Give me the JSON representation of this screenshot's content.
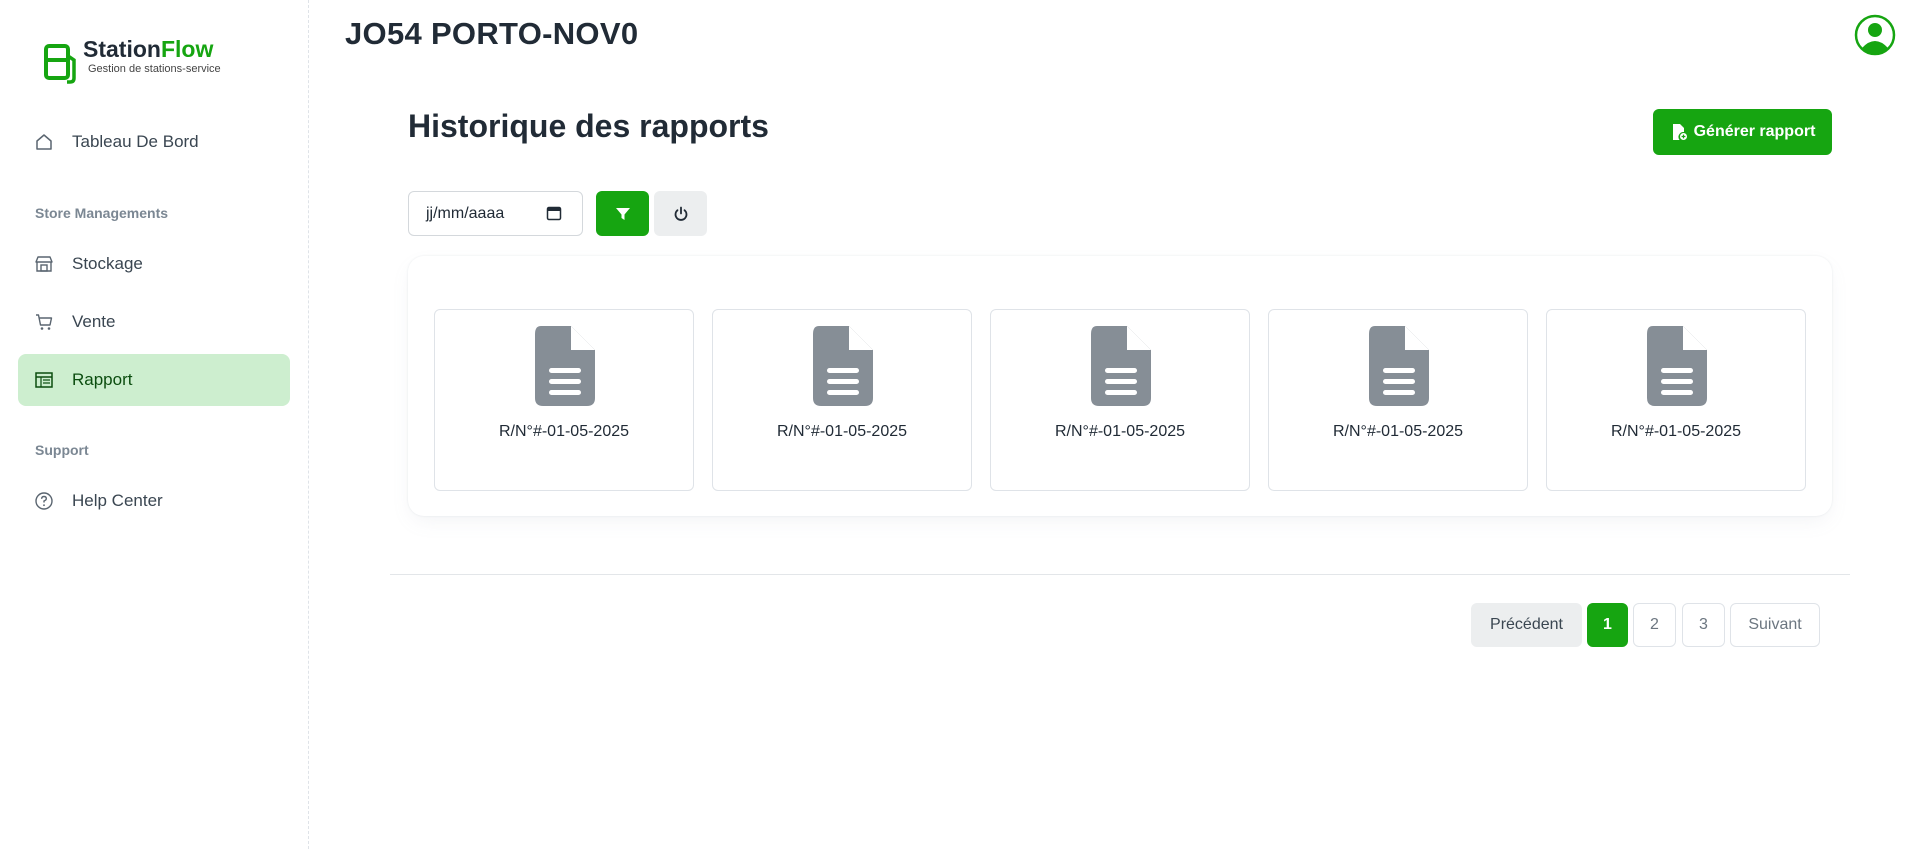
{
  "brand": {
    "name_part1": "Station",
    "name_part2": "Flow",
    "tagline": "Gestion de stations-service",
    "accent_color": "#16a511"
  },
  "sidebar": {
    "items": [
      {
        "label": "Tableau De Bord",
        "icon": "home-icon"
      },
      {
        "label": "Stockage",
        "icon": "store-icon"
      },
      {
        "label": "Vente",
        "icon": "cart-icon"
      },
      {
        "label": "Rapport",
        "icon": "report-icon",
        "active": true
      },
      {
        "label": "Help Center",
        "icon": "help-icon"
      }
    ],
    "sections": {
      "store": "Store Managements",
      "support": "Support"
    }
  },
  "header": {
    "store_name": "JO54 PORTO-NOV0",
    "avatar_icon": "user-avatar-icon"
  },
  "main": {
    "title": "Historique des rapports",
    "generate_button": "Générer rapport",
    "date_filter": {
      "placeholder": "jj/mm/aaaa"
    },
    "filter_icon": "funnel-icon",
    "reset_icon": "power-icon",
    "reports": [
      {
        "label": "R/N°#-01-05-2025"
      },
      {
        "label": "R/N°#-01-05-2025"
      },
      {
        "label": "R/N°#-01-05-2025"
      },
      {
        "label": "R/N°#-01-05-2025"
      },
      {
        "label": "R/N°#-01-05-2025"
      }
    ]
  },
  "pagination": {
    "previous": "Précédent",
    "pages": [
      "1",
      "2",
      "3"
    ],
    "current": "1",
    "next": "Suivant"
  }
}
